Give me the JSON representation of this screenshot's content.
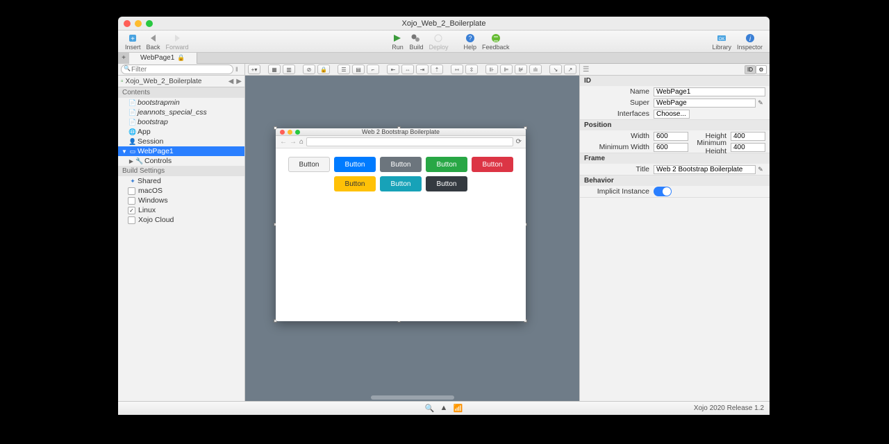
{
  "window_title": "Xojo_Web_2_Boilerplate",
  "toolbar": {
    "insert": "Insert",
    "back": "Back",
    "forward": "Forward",
    "run": "Run",
    "build": "Build",
    "deploy": "Deploy",
    "help": "Help",
    "feedback": "Feedback",
    "library": "Library",
    "inspector": "Inspector"
  },
  "tab": {
    "name": "WebPage1"
  },
  "nav": {
    "filter_placeholder": "Filter",
    "project": "Xojo_Web_2_Boilerplate",
    "contents_hdr": "Contents",
    "items": {
      "bootstrapmin": "bootstrapmin",
      "jeannots": "jeannots_special_css",
      "bootstrap": "bootstrap",
      "app": "App",
      "session": "Session",
      "webpage1": "WebPage1",
      "controls": "Controls"
    },
    "build_hdr": "Build Settings",
    "build": {
      "shared": "Shared",
      "macos": "macOS",
      "windows": "Windows",
      "linux": "Linux",
      "xojo_cloud": "Xojo Cloud"
    }
  },
  "designer": {
    "win_title": "Web 2 Bootstrap Boilerplate",
    "buttons": [
      "Button",
      "Button",
      "Button",
      "Button",
      "Button",
      "Button",
      "Button",
      "Button"
    ]
  },
  "inspector": {
    "id_hdr": "ID",
    "name_lbl": "Name",
    "name_val": "WebPage1",
    "super_lbl": "Super",
    "super_val": "WebPage",
    "interfaces_lbl": "Interfaces",
    "interfaces_val": "Choose...",
    "pos_hdr": "Position",
    "width_lbl": "Width",
    "width_val": "600",
    "height_lbl": "Height",
    "height_val": "400",
    "minw_lbl": "Minimum Width",
    "minw_val": "600",
    "minh_lbl": "Minimum Height",
    "minh_val": "400",
    "frame_hdr": "Frame",
    "title_lbl": "Title",
    "title_val": "Web 2 Bootstrap Boilerplate",
    "beh_hdr": "Behavior",
    "implicit_lbl": "Implicit Instance"
  },
  "status": {
    "version": "Xojo 2020 Release 1.2"
  }
}
